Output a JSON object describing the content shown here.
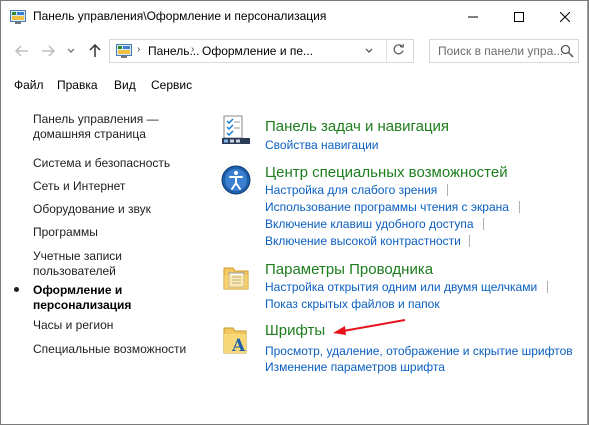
{
  "window": {
    "title": "Панель управления\\Оформление и персонализация"
  },
  "address_bar": {
    "crumb1": "Панель...",
    "crumb2": "Оформление и пе...",
    "search_placeholder": "Поиск в панели упра..."
  },
  "menu": {
    "file": "Файл",
    "edit": "Правка",
    "view": "Вид",
    "service": "Сервис"
  },
  "sidebar": {
    "home_line1": "Панель управления —",
    "home_line2": "домашняя страница",
    "items": [
      "Система и безопасность",
      "Сеть и Интернет",
      "Оборудование и звук",
      "Программы",
      "Учетные записи",
      "пользователей",
      "Оформление и",
      "персонализация",
      "Часы и регион",
      "Специальные возможности"
    ]
  },
  "categories": {
    "taskbar": {
      "title": "Панель задач и навигация",
      "links": [
        "Свойства навигации"
      ]
    },
    "access": {
      "title": "Центр специальных возможностей",
      "links": [
        "Настройка для слабого зрения",
        "Использование программы чтения с экрана",
        "Включение клавиш удобного доступа",
        "Включение высокой контрастности"
      ]
    },
    "explorer": {
      "title": "Параметры Проводника",
      "links": [
        "Настройка открытия одним или двумя щелчками",
        "Показ скрытых файлов и папок"
      ]
    },
    "fonts": {
      "title": "Шрифты",
      "links": [
        "Просмотр, удаление, отображение и скрытие шрифтов",
        "Изменение параметров шрифта"
      ]
    }
  },
  "colors": {
    "category_title": "#1e7e1e",
    "link": "#0a5fc0",
    "annotation_arrow": "#e8121a"
  },
  "icons": {
    "title": "control-panel-icon",
    "taskbar": "taskbar-icon",
    "access": "ease-of-access-icon",
    "explorer": "folder-options-icon",
    "fonts": "fonts-folder-icon"
  }
}
